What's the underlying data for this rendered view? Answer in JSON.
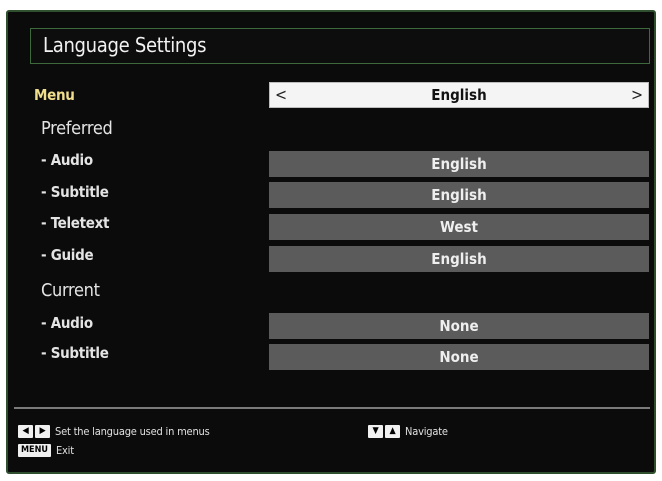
{
  "header": {
    "title": "Language Settings"
  },
  "menu": {
    "label": "Menu",
    "value": "English",
    "prev_icon": "chevron-left-icon",
    "next_icon": "chevron-right-icon"
  },
  "preferred": {
    "heading": "Preferred",
    "rows": [
      {
        "label": "- Audio",
        "value": "English"
      },
      {
        "label": "- Subtitle",
        "value": "English"
      },
      {
        "label": "- Teletext",
        "value": "West"
      },
      {
        "label": "- Guide",
        "value": "English"
      }
    ]
  },
  "current": {
    "heading": "Current",
    "rows": [
      {
        "label": "- Audio",
        "value": "None"
      },
      {
        "label": "- Subtitle",
        "value": "None"
      }
    ]
  },
  "footer": {
    "left_right_hint": "Set the language used in menus",
    "menu_key": "MENU",
    "menu_hint": "Exit",
    "navigate_hint": "Navigate"
  },
  "colors": {
    "background": "#0b0b0b",
    "frame_border": "#2f4f2f",
    "selected_bg": "#f4f4f4",
    "option_bg": "#5b5b5b",
    "menu_label": "#f0de8c"
  }
}
